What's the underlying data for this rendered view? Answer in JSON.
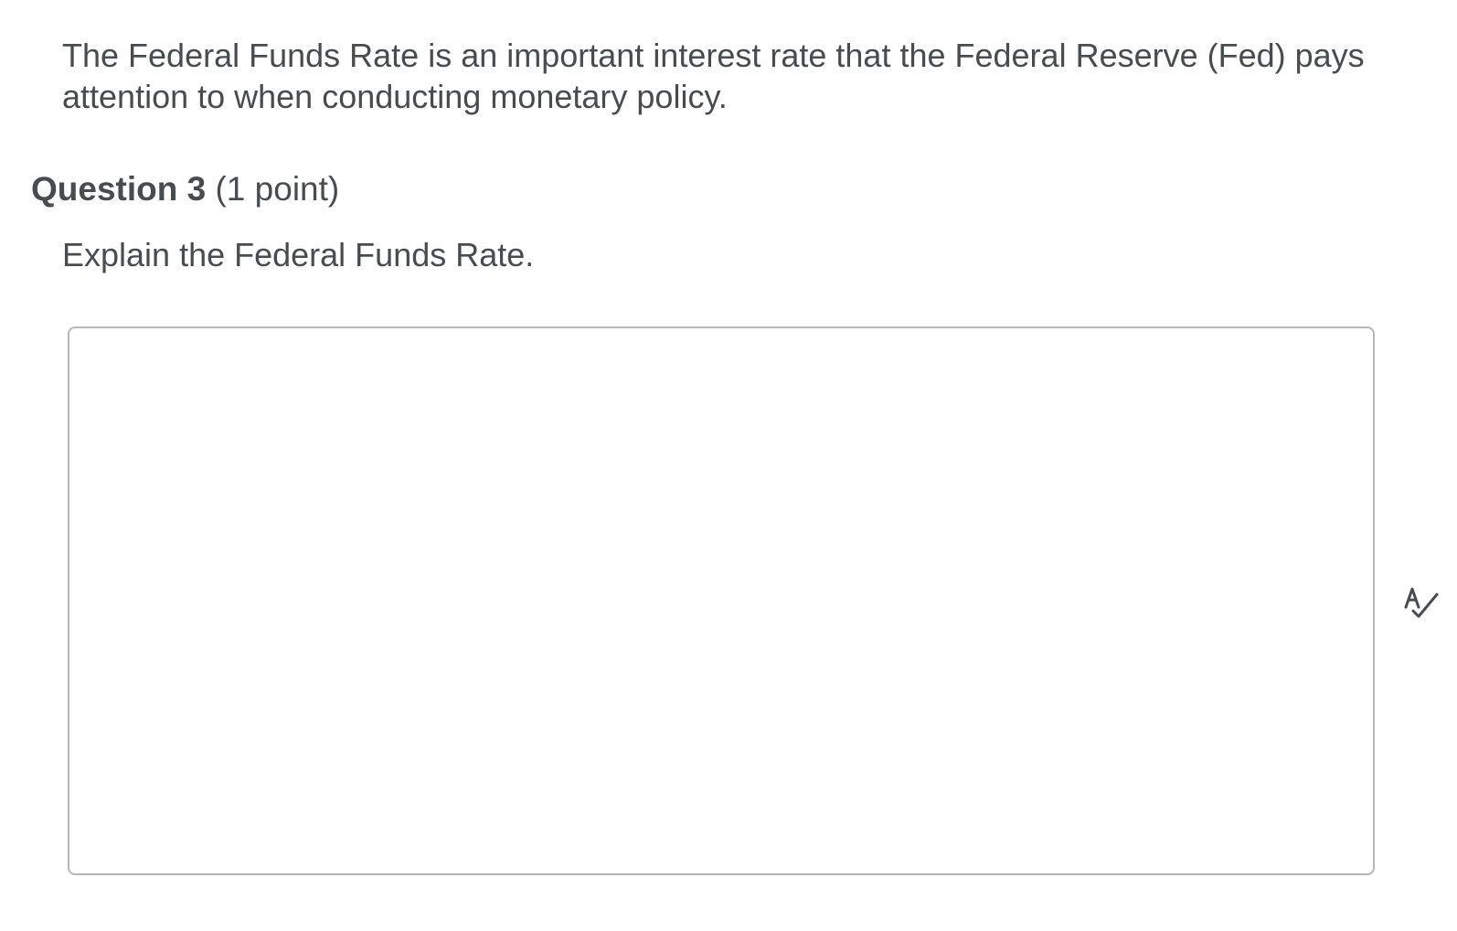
{
  "intro": {
    "text": "The Federal Funds Rate is an important interest rate that the Federal Reserve (Fed) pays attention to when conducting monetary policy."
  },
  "question": {
    "title": "Question 3",
    "points": " (1 point)",
    "prompt": "Explain the Federal Funds Rate."
  },
  "answer": {
    "value": ""
  },
  "icons": {
    "spellcheck": "spellcheck-icon"
  },
  "colors": {
    "text": "#494c4e",
    "border": "#b5b8ba"
  }
}
